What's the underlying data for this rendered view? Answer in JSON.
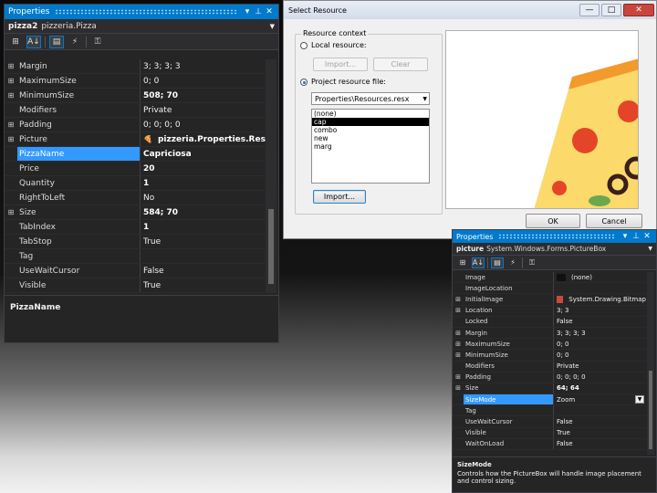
{
  "left_panel": {
    "title": "Properties",
    "object_name": "pizza2",
    "object_type": "pizzeria.Pizza",
    "rows": [
      {
        "expand": "⊞",
        "name": "Margin",
        "value": "3; 3; 3; 3"
      },
      {
        "expand": "⊞",
        "name": "MaximumSize",
        "value": "0; 0"
      },
      {
        "expand": "⊞",
        "name": "MinimumSize",
        "value": "508; 70",
        "bold": true
      },
      {
        "expand": "",
        "name": "Modifiers",
        "value": "Private"
      },
      {
        "expand": "⊞",
        "name": "Padding",
        "value": "0; 0; 0; 0"
      },
      {
        "expand": "⊞",
        "name": "Picture",
        "value": "pizzeria.Properties.Resources.cap",
        "bold": true,
        "icon": true
      },
      {
        "expand": "",
        "name": "PizzaName",
        "value": "Capriciosa",
        "bold": true,
        "selected": true
      },
      {
        "expand": "",
        "name": "Price",
        "value": "20",
        "bold": true
      },
      {
        "expand": "",
        "name": "Quantity",
        "value": "1",
        "bold": true
      },
      {
        "expand": "",
        "name": "RightToLeft",
        "value": "No"
      },
      {
        "expand": "⊞",
        "name": "Size",
        "value": "584; 70",
        "bold": true
      },
      {
        "expand": "",
        "name": "TabIndex",
        "value": "1",
        "bold": true
      },
      {
        "expand": "",
        "name": "TabStop",
        "value": "True"
      },
      {
        "expand": "",
        "name": "Tag",
        "value": ""
      },
      {
        "expand": "",
        "name": "UseWaitCursor",
        "value": "False"
      },
      {
        "expand": "",
        "name": "Visible",
        "value": "True"
      }
    ],
    "description_title": "PizzaName"
  },
  "dialog": {
    "title": "Select Resource",
    "group_label": "Resource context",
    "local_resource_label": "Local resource:",
    "import_label": "Import...",
    "clear_label": "Clear",
    "project_resource_label": "Project resource file:",
    "resource_file": "Properties\\Resources.resx",
    "resources": [
      "(none)",
      "cap",
      "combo",
      "new",
      "marg"
    ],
    "selected_resource": "cap",
    "import2_label": "Import...",
    "ok_label": "OK",
    "cancel_label": "Cancel"
  },
  "right_panel": {
    "title": "Properties",
    "object_name": "picture",
    "object_type": "System.Windows.Forms.PictureBox",
    "rows": [
      {
        "expand": "",
        "name": "Image",
        "value": "(none)",
        "swatch": "#111111"
      },
      {
        "expand": "",
        "name": "ImageLocation",
        "value": ""
      },
      {
        "expand": "⊞",
        "name": "InitialImage",
        "value": "System.Drawing.Bitmap",
        "swatch": "#c94a3a"
      },
      {
        "expand": "⊞",
        "name": "Location",
        "value": "3; 3"
      },
      {
        "expand": "",
        "name": "Locked",
        "value": "False"
      },
      {
        "expand": "⊞",
        "name": "Margin",
        "value": "3; 3; 3; 3"
      },
      {
        "expand": "⊞",
        "name": "MaximumSize",
        "value": "0; 0"
      },
      {
        "expand": "⊞",
        "name": "MinimumSize",
        "value": "0; 0"
      },
      {
        "expand": "",
        "name": "Modifiers",
        "value": "Private"
      },
      {
        "expand": "⊞",
        "name": "Padding",
        "value": "0; 0; 0; 0"
      },
      {
        "expand": "⊞",
        "name": "Size",
        "value": "64; 64",
        "bold": true
      },
      {
        "expand": "",
        "name": "SizeMode",
        "value": "Zoom",
        "selected": true,
        "dropdown": true
      },
      {
        "expand": "",
        "name": "Tag",
        "value": ""
      },
      {
        "expand": "",
        "name": "UseWaitCursor",
        "value": "False"
      },
      {
        "expand": "",
        "name": "Visible",
        "value": "True"
      },
      {
        "expand": "",
        "name": "WaitOnLoad",
        "value": "False"
      }
    ],
    "description_title": "SizeMode",
    "description_text": "Controls how the PictureBox will handle image placement and control sizing."
  },
  "icons": {
    "categorized": "⊞",
    "alphabetical": "A↓",
    "properties": "▤",
    "events": "⚡",
    "property_pages": "🔑",
    "pin": "📌",
    "close": "✕",
    "dropdown": "▾",
    "minimize": "—",
    "maximize": "□"
  }
}
